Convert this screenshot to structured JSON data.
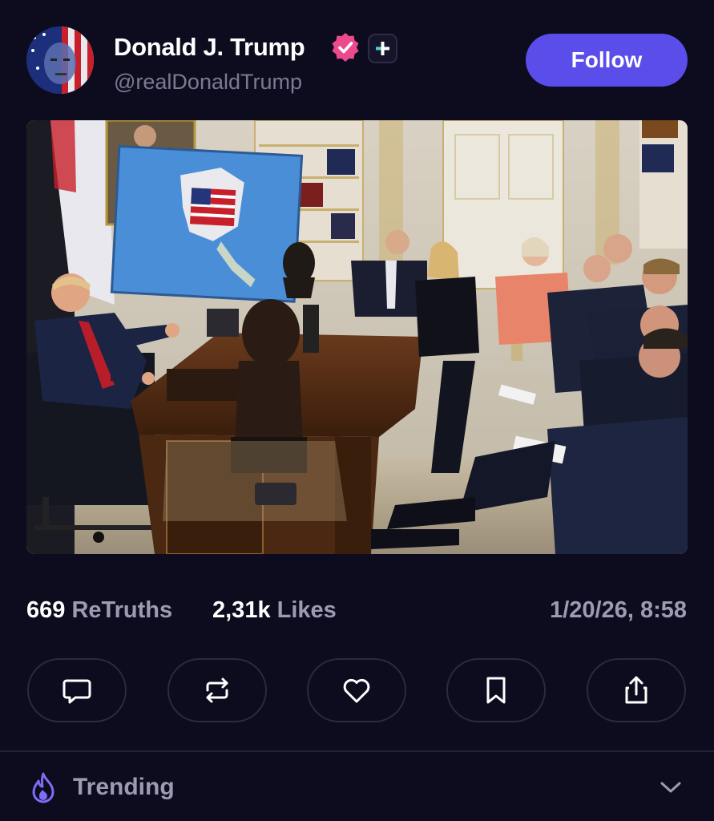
{
  "post": {
    "author": {
      "display_name": "Donald J. Trump",
      "handle": "@realDonaldTrump"
    },
    "follow_label": "Follow",
    "stats": {
      "retruths_count": "669",
      "retruths_label": "ReTruths",
      "likes_count": "2,31k",
      "likes_label": "Likes"
    },
    "timestamp": "1/20/26, 8:58"
  },
  "actions": [
    {
      "icon": "comment-icon"
    },
    {
      "icon": "retruth-icon"
    },
    {
      "icon": "heart-icon"
    },
    {
      "icon": "bookmark-icon"
    },
    {
      "icon": "share-icon"
    }
  ],
  "trending": {
    "label": "Trending"
  },
  "colors": {
    "background": "#0d0c1f",
    "accent": "#5b4dea",
    "verified": "#ec4a8c",
    "muted_text": "#9c9bb2"
  }
}
